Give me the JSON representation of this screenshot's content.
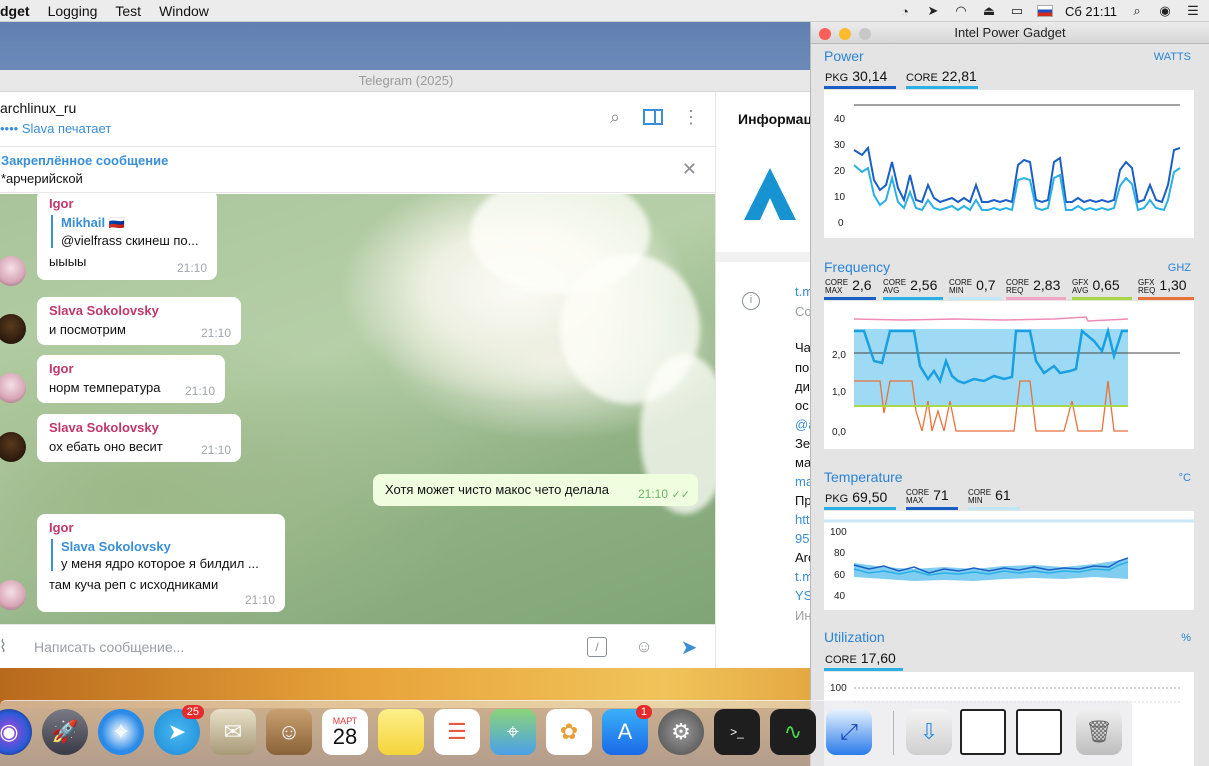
{
  "menubar": {
    "app_name": "dget",
    "items": [
      "Logging",
      "Test",
      "Window"
    ],
    "clock": "Сб 21:11"
  },
  "telegram": {
    "window_title": "Telegram (2025)",
    "chat_name": "archlinux_ru",
    "chat_status": "•••• Slava печатает",
    "pinned_title": "Закреплённое сообщение",
    "pinned_text": "*арчерийской",
    "composer_placeholder": "Написать сообщение...",
    "messages": [
      {
        "sender": "Igor",
        "reply_name": "Mikhail 🇷🇺",
        "reply_text": "@vielfrass скинеш по...",
        "text": "ыыыы",
        "time": "21:10"
      },
      {
        "sender": "Slava Sokolovsky",
        "text": "и посмотрим",
        "time": "21:10"
      },
      {
        "sender": "Igor",
        "text": "норм температура",
        "time": "21:10"
      },
      {
        "sender": "Slava Sokolovsky",
        "text": "ох ебать оно весит",
        "time": "21:10"
      },
      {
        "text": "Хотя может чисто макос чето делала",
        "time": "21:10"
      },
      {
        "sender": "Igor",
        "reply_name": "Slava Sokolovsky",
        "reply_text": "у меня ядро которое я билдил ...",
        "text": "там куча реп с исходниками",
        "time": "21:10"
      }
    ],
    "info": {
      "title": "Информаци",
      "lines": [
        "t.m",
        "Со",
        "Ча",
        "по",
        "ди",
        "ос",
        "@a",
        "Зе",
        "ма",
        "ma",
        "Пр",
        "htt",
        "95",
        "Arc",
        "t.m",
        "YS",
        "Ин"
      ]
    }
  },
  "power_gadget": {
    "title": "Intel Power Gadget",
    "power": {
      "title": "Power",
      "unit": "WATTS",
      "pkg_label": "PKG",
      "pkg_value": "30,14",
      "core_label": "CORE",
      "core_value": "22,81",
      "y_ticks": [
        "40",
        "30",
        "20",
        "10",
        "0"
      ]
    },
    "frequency": {
      "title": "Frequency",
      "unit": "GHZ",
      "core_max_value": "2,6",
      "core_avg_value": "2,56",
      "core_min_value": "0,7",
      "core_req_value": "2,83",
      "gfx_avg_value": "0,65",
      "gfx_req_value": "1,30",
      "y_ticks": [
        "2,0",
        "1,0",
        "0,0"
      ]
    },
    "temperature": {
      "title": "Temperature",
      "unit": "°C",
      "pkg_label": "PKG",
      "pkg_value": "69,50",
      "core_max_value": "71",
      "core_min_value": "61",
      "y_ticks": [
        "100",
        "80",
        "60",
        "40"
      ]
    },
    "utilization": {
      "title": "Utilization",
      "unit": "%",
      "core_label": "CORE",
      "core_value": "17,60",
      "y_ticks": [
        "100"
      ]
    }
  },
  "dock": {
    "telegram_badge": "25",
    "appstore_badge": "1",
    "calendar_month": "МАРТ",
    "calendar_day": "28"
  }
}
